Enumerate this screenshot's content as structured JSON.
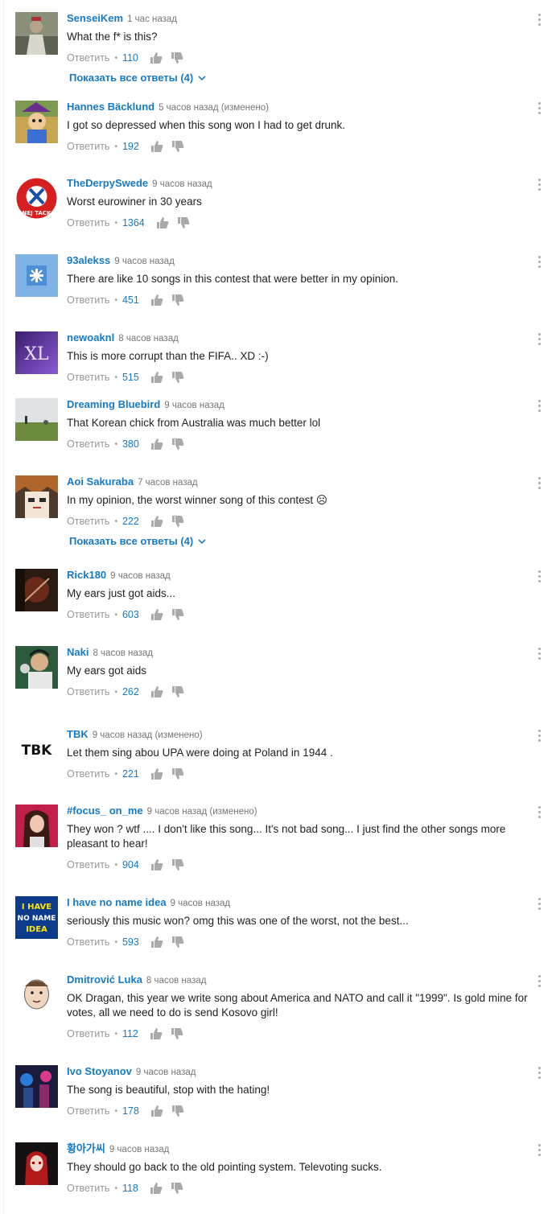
{
  "ui": {
    "reply_label": "Ответить",
    "show_all_replies": "Показать все ответы (4)",
    "colors": {
      "link": "#167ac6",
      "muted": "#767676"
    }
  },
  "comments": [
    {
      "author": "SenseiKem",
      "time": "1 час назад",
      "text": "What the f* is this?",
      "likes": "110",
      "avatar": "grey-figure",
      "replies": true
    },
    {
      "author": "Hannes Bäcklund",
      "time": "5 часов назад (изменено)",
      "text": "I got so depressed when this song won I had to get drunk.",
      "likes": "192",
      "avatar": "cartoon-character"
    },
    {
      "author": "TheDerpySwede",
      "time": "9 часов назад",
      "text": "Worst eurowiner in 30 years",
      "likes": "1364",
      "avatar": "nej-tack-badge"
    },
    {
      "author": "93alekss",
      "time": "9 часов назад",
      "text": "There are like 10 songs in this contest that were better in my opinion.",
      "likes": "451",
      "avatar": "blue-default"
    },
    {
      "author": "newoaknl",
      "time": "8 часов назад",
      "text": "This is more corrupt than the FIFA.. XD :-)",
      "likes": "515",
      "avatar": "xl-purple"
    },
    {
      "author": "Dreaming Bluebird",
      "time": "9 часов назад",
      "text": "That Korean chick from Australia was much better lol",
      "likes": "380",
      "avatar": "field-landscape"
    },
    {
      "author": "Aoi Sakuraba",
      "time": "7 часов назад",
      "text": "In my opinion, the worst winner song of this contest ☹",
      "likes": "222",
      "avatar": "anime-face",
      "replies": true
    },
    {
      "author": "Rick180",
      "time": "9 часов назад",
      "text": "My ears just got aids...",
      "likes": "603",
      "avatar": "dark-red-art"
    },
    {
      "author": "Naki",
      "time": "8 часов назад",
      "text": "My ears got aids",
      "likes": "262",
      "avatar": "person-smoke"
    },
    {
      "author": "TBK",
      "time": "9 часов назад (изменено)",
      "text": "Let them sing abou UPA were doing  at Poland in 1944 .",
      "likes": "221",
      "avatar": "tbk-logo",
      "logo_text": "TBK"
    },
    {
      "author": "#focus_ on_me",
      "time": "9 часов назад (изменено)",
      "text": "They won ? wtf .... I don't like this song... It's not bad song... I just find the other songs more pleasant to hear!",
      "likes": "904",
      "avatar": "woman-portrait"
    },
    {
      "author": "I have no name idea",
      "time": "9 часов назад",
      "text": "seriously this music won? omg this was one of the worst, not the best...",
      "likes": "593",
      "avatar": "text-logo",
      "logo_lines": [
        "I HAVE",
        "NO NAME",
        "IDEA"
      ]
    },
    {
      "author": "Dmitrović Luka",
      "time": "8 часов назад",
      "text": "OK Dragan, this year we write song about America and NATO and call it \"1999\". Is gold mine for votes, all we need to do is send Kosovo girl!",
      "likes": "112",
      "avatar": "face-meme"
    },
    {
      "author": "Ivo Stoyanov",
      "time": "9 часов назад",
      "text": "The song is beautiful, stop with the hating!",
      "likes": "178",
      "avatar": "concert-photo"
    },
    {
      "author": "황아가씨",
      "time": "9 часов назад",
      "text": "They should go back to the old pointing system. Televoting sucks.",
      "likes": "118",
      "avatar": "red-hair-character"
    }
  ]
}
